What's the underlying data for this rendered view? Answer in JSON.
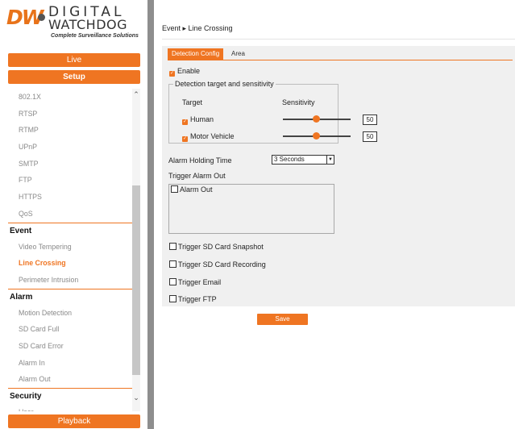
{
  "brand": {
    "logo_dw": "DW",
    "logo_line1": "DIGITAL",
    "logo_line2": "WATCHDOG",
    "tagline": "Complete Surveillance Solutions",
    "accent_color": "#ef7522"
  },
  "nav": {
    "live": "Live",
    "setup": "Setup",
    "playback": "Playback"
  },
  "menu": {
    "network_items": [
      "802.1X",
      "RTSP",
      "RTMP",
      "UPnP",
      "SMTP",
      "FTP",
      "HTTPS",
      "QoS"
    ],
    "event_header": "Event",
    "event_items": [
      "Video Tempering",
      "Line Crossing",
      "Perimeter Intrusion"
    ],
    "alarm_header": "Alarm",
    "alarm_items": [
      "Motion Detection",
      "SD Card Full",
      "SD Card Error",
      "Alarm In",
      "Alarm Out"
    ],
    "security_header": "Security",
    "security_items": [
      "User"
    ],
    "active_item": "Line Crossing"
  },
  "breadcrumb": "Event ▸ Line Crossing",
  "tabs": [
    "Detection Config",
    "Area"
  ],
  "form": {
    "enable_label": "Enable",
    "group_title": "Detection target and sensitivity",
    "col_target": "Target",
    "col_sensitivity": "Sensitivity",
    "targets": [
      {
        "label": "Human",
        "checked": true,
        "sensitivity": "50"
      },
      {
        "label": "Motor Vehicle",
        "checked": true,
        "sensitivity": "50"
      }
    ],
    "alarm_holding_label": "Alarm Holding Time",
    "alarm_holding_value": "3 Seconds",
    "trigger_alarm_out_label": "Trigger Alarm Out",
    "alarm_out_label": "Alarm Out",
    "snapshot_label": "Trigger SD Card Snapshot",
    "recording_label": "Trigger SD Card Recording",
    "email_label": "Trigger Email",
    "ftp_label": "Trigger FTP"
  },
  "save_label": "Save"
}
